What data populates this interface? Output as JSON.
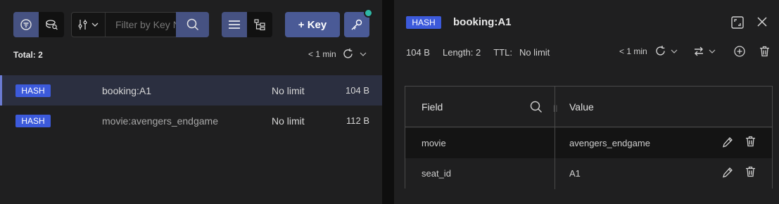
{
  "toolbar": {
    "filter_placeholder": "Filter by Key Name or Pattern",
    "add_key_label": "+ Key"
  },
  "list_header": {
    "total_label": "Total: 2",
    "last_refresh": "< 1 min"
  },
  "keys": [
    {
      "type": "HASH",
      "name": "booking:A1",
      "ttl": "No limit",
      "size": "104 B",
      "selected": true
    },
    {
      "type": "HASH",
      "name": "movie:avengers_endgame",
      "ttl": "No limit",
      "size": "112 B",
      "selected": false
    }
  ],
  "details": {
    "type": "HASH",
    "key_name": "booking:A1",
    "size": "104 B",
    "length": "Length: 2",
    "ttl_label": "TTL:",
    "ttl_value": "No limit",
    "last_refresh": "< 1 min",
    "table": {
      "headers": {
        "field": "Field",
        "value": "Value"
      },
      "rows": [
        {
          "field": "movie",
          "value": "avengers_endgame"
        },
        {
          "field": "seat_id",
          "value": "A1"
        }
      ]
    }
  },
  "colors": {
    "accent": "#465282",
    "badge": "#3c5adb",
    "notification": "#2fb8a6",
    "selected_row": "#2b2f40"
  },
  "icons": [
    "filter-icon",
    "database-icon",
    "key-type-filter-icon",
    "search-icon",
    "list-view-icon",
    "tree-view-icon",
    "settings-icon",
    "refresh-icon",
    "expand-icon",
    "close-icon",
    "swap-format-icon",
    "add-field-icon",
    "delete-icon",
    "edit-icon"
  ]
}
